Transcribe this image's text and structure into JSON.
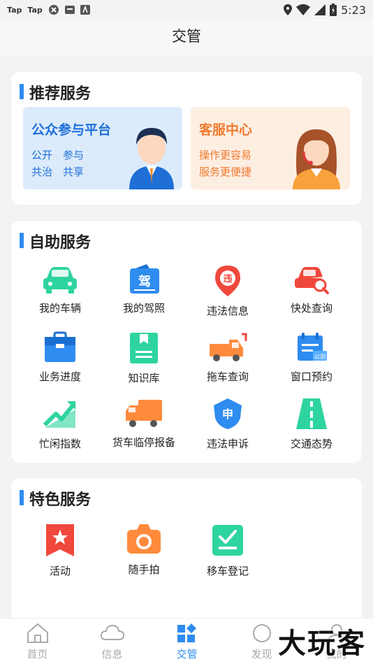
{
  "status_bar": {
    "left_items": [
      "Tap",
      "Tap"
    ],
    "time": "5:23"
  },
  "header": {
    "title": "交管"
  },
  "recommended": {
    "title": "推荐服务",
    "banners": [
      {
        "title": "公众参与平台",
        "line1": "公开　参与",
        "line2": "共治　共享"
      },
      {
        "title": "客服中心",
        "line1": "操作更容易",
        "line2": "服务更便捷"
      }
    ]
  },
  "self_service": {
    "title": "自助服务",
    "items": [
      {
        "label": "我的车辆",
        "icon": "car-icon"
      },
      {
        "label": "我的驾照",
        "icon": "license-icon"
      },
      {
        "label": "违法信息",
        "icon": "violation-pin-icon"
      },
      {
        "label": "快处查询",
        "icon": "car-search-icon"
      },
      {
        "label": "业务进度",
        "icon": "briefcase-icon"
      },
      {
        "label": "知识库",
        "icon": "book-icon"
      },
      {
        "label": "拖车查询",
        "icon": "tow-truck-icon"
      },
      {
        "label": "窗口预约",
        "icon": "calendar-icon"
      },
      {
        "label": "忙闲指数",
        "icon": "trend-up-icon"
      },
      {
        "label": "货车临停报备",
        "icon": "truck-icon"
      },
      {
        "label": "违法申诉",
        "icon": "appeal-shield-icon"
      },
      {
        "label": "交通态势",
        "icon": "road-icon"
      }
    ]
  },
  "featured": {
    "title": "特色服务",
    "items": [
      {
        "label": "活动",
        "icon": "star-bookmark-icon"
      },
      {
        "label": "随手拍",
        "icon": "camera-icon"
      },
      {
        "label": "移车登记",
        "icon": "check-register-icon"
      }
    ]
  },
  "tab_bar": {
    "tabs": [
      {
        "label": "首页",
        "icon": "home-icon"
      },
      {
        "label": "信息",
        "icon": "cloud-icon"
      },
      {
        "label": "交管",
        "icon": "grid-diamond-icon",
        "active": true
      },
      {
        "label": "发现",
        "icon": "discover-icon"
      },
      {
        "label": "我的",
        "icon": "profile-icon"
      }
    ]
  },
  "watermark": "大玩客",
  "colors": {
    "accent": "#2f8cf0",
    "green": "#2ed4a0",
    "red": "#f0483c",
    "orange": "#ff8a3c"
  }
}
